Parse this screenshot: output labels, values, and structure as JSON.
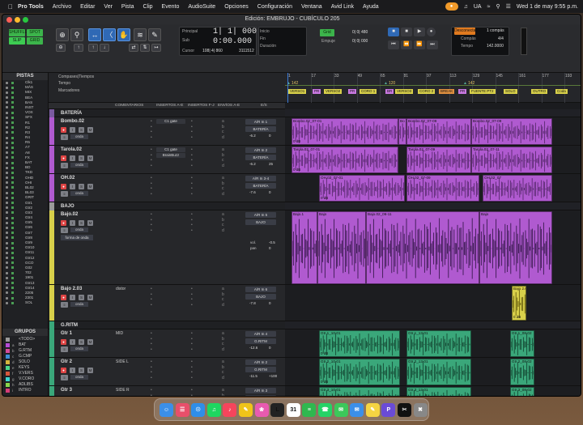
{
  "menubar": {
    "app": "Pro Tools",
    "items": [
      "Archivo",
      "Editar",
      "Ver",
      "Pista",
      "Clip",
      "Evento",
      "AudioSuite",
      "Opciones",
      "Configuración",
      "Ventana",
      "Avid Link",
      "Ayuda"
    ],
    "lang": "UA",
    "clock": "Wed 1 de may  9:55 p.m."
  },
  "window": {
    "title": "Edición: EMBRUJO - CUBÍCULO 205"
  },
  "toolbar": {
    "modes": [
      "SHUFFLE",
      "SPOT",
      "SLIP",
      "GRID"
    ],
    "principal_label": "Principal",
    "principal_value": "1| 1| 000",
    "sub_label": "Sub",
    "sub_value": "0:00.000",
    "cursor_label": "Cursor",
    "cursor_value": "108| 4| 860",
    "cursor_samples": "3111512",
    "inicio_label": "Inicio",
    "fin_label": "Fin",
    "duracion_label": "Duración",
    "grid_label": "Grid",
    "grid_value": "0| 0| 480",
    "empuje_label": "Empuje",
    "empuje_value": "0| 0| 000",
    "compas_label": "Compás",
    "compas_value": "4/4",
    "tempo_label": "Tempo",
    "tempo_value": "142.0000",
    "countoff_label": "Desconectado",
    "countoff_value": "1 compás"
  },
  "panels": {
    "tracks_title": "PISTAS",
    "tracks": [
      "Clk1",
      "MÁS",
      "MIX",
      "BEA",
      "BAS",
      "INST",
      "VOX",
      "SFX",
      "R1",
      "R2",
      "R3",
      "R4",
      "R5",
      "A7",
      "A8",
      "FX",
      "BAT",
      "BD",
      "TKD",
      "OHD",
      "OHI",
      "BL02",
      "BL03",
      "GRIT",
      "Gtr1",
      "Gtr2",
      "Gtr3",
      "Gtr4",
      "Gtr5",
      "Gtr6",
      "Gtr7",
      "Gtr8",
      "Gtr9",
      "Gtr10",
      "Gtr11",
      "Gtr12",
      "GCO",
      "G02",
      "702",
      "1901",
      "Gtr13",
      "Gtr14",
      "2205",
      "2301",
      "SOL"
    ],
    "groups_title": "GRUPOS",
    "groups": [
      {
        "key": "",
        "name": "<TODO>",
        "color": "#999999"
      },
      {
        "key": "a",
        "name": "BAT",
        "color": "#b64bd6"
      },
      {
        "key": "b",
        "name": "G.RTM",
        "color": "#d64b9a"
      },
      {
        "key": "c",
        "name": "G.CMP",
        "color": "#3c8fd6"
      },
      {
        "key": "d",
        "name": "SOLO",
        "color": "#d6b43c"
      },
      {
        "key": "e",
        "name": "KEYS",
        "color": "#4bd68a"
      },
      {
        "key": "f",
        "name": "V.VERS",
        "color": "#d6563c"
      },
      {
        "key": "g",
        "name": "V.CORO",
        "color": "#3cd6d0"
      },
      {
        "key": "h",
        "name": "ADLIBS",
        "color": "#8ad64b"
      },
      {
        "key": "i",
        "name": "INTRO",
        "color": "#d63c78"
      }
    ]
  },
  "ruler": {
    "rows": [
      "Compases|Tiempos",
      "Tempo",
      "Marcadores"
    ],
    "bars": [
      "1",
      "17",
      "33",
      "49",
      "65",
      "81",
      "97",
      "113",
      "129",
      "145",
      "161",
      "177",
      "193"
    ],
    "tempo_values": [
      "142",
      "120",
      "142"
    ],
    "markers": [
      "VERSO1",
      "PR",
      "VERSO2",
      "PR",
      "CORO 1",
      "BR",
      "VERSO3",
      "CORO 2",
      "BREAK",
      "PR",
      "FUENTE PT2",
      "SOLO",
      "OUTRO",
      "Coda"
    ]
  },
  "columns": [
    "COMENTARIOS",
    "INSERTOS A-E",
    "INSERTOS F-J",
    "ENVÍOS A-E",
    "E/S"
  ],
  "folders": {
    "bateria": "BATERÍA",
    "bajo": "BAJO",
    "gritm": "G.RITM"
  },
  "tracks": [
    {
      "name": "Bombo.02",
      "comment": "",
      "insert": "C1 gate",
      "input": "A/R In 1",
      "output": "BATERÍA",
      "vol": "-6.2",
      "pan": "0",
      "clips": [
        "Bombo.02_07-01",
        "Bo",
        "Bombo.02_07-09",
        "Bombo.02_07-09",
        "Bombo.02_07-12"
      ],
      "db": "0 dB"
    },
    {
      "name": "Tarola.02",
      "comment": "",
      "insert": "C1 gate",
      "insert2": "BrainBuzz",
      "input": "A/R In 2",
      "output": "BATERÍA",
      "vol": "-6.2",
      "pan": "25",
      "clips": [
        "Tarola.02_07-01",
        "Tarola.02_07-09",
        "Tarola.02_07-11",
        "Tarola.02_07-08"
      ],
      "db": "0 dB"
    },
    {
      "name": "OH.02",
      "comment": "",
      "insert": "",
      "input": "A/R In 3-4",
      "output": "BATERÍA",
      "vol": "-7.6",
      "pan": "0",
      "clips": [
        "OH.02_07-01",
        "OH.02_07-09",
        "OH.02_07",
        "OH.02_07-13"
      ],
      "db": "0 dB"
    },
    {
      "name": "Bajo.02",
      "comment": "",
      "insert": "",
      "input": "A/R In 5",
      "output": "BAJO",
      "vol": "-0.5",
      "pan": "0",
      "clips": [
        "Bajo.1",
        "Bajo",
        "Bajo.02_06-11",
        "Bajo"
      ],
      "mode": "forma de onda",
      "vol_label": "vol.",
      "pan_label": "pan"
    },
    {
      "name": "Bajo 2.03",
      "comment": "distor",
      "insert": "",
      "input": "A/R In 6",
      "output": "BAJO",
      "vol": "-7.8",
      "pan": "0",
      "clips": [
        "Bajo 2.03"
      ],
      "db": "0 dB"
    },
    {
      "name": "Gtr 1",
      "comment": "MID",
      "insert": "",
      "input": "A/R In 4",
      "output": "G.RITM",
      "vol": "-12.6",
      "pan": "0",
      "clips": [
        "Gtr 1_10-01",
        "Gtr 1_13-01",
        "Gtr 1_08-02"
      ],
      "db": "0 dB"
    },
    {
      "name": "Gtr 2",
      "comment": "SIDE L",
      "insert": "",
      "input": "A/R In 2",
      "output": "G.RITM",
      "vol": "-11.5",
      "pan": "+100",
      "clips": [
        "Gtr 2_10-01",
        "Gtr 2_13-01",
        "Gtr 2_08-02"
      ],
      "db": "0 dB"
    },
    {
      "name": "Gtr 3",
      "comment": "SIDE R",
      "insert": "",
      "input": "A/R In 3",
      "output": "G.RITM",
      "vol": "",
      "pan": "",
      "clips": [
        "Gtr 3_10-01",
        "Gtr 3_13-01",
        "Gtr 3_08-02"
      ],
      "db": "0 dB"
    }
  ],
  "dock": [
    "Finder",
    "Launchpad",
    "Safari",
    "Spotify",
    "Music",
    "Notes",
    "Photos",
    "Live",
    "Calendar",
    "Numbers",
    "WhatsApp",
    "Messages",
    "Mail",
    "Notes2",
    "Pro Tools",
    "Capcut",
    "Trash"
  ],
  "colors": {
    "purple": "#b05ad0",
    "green": "#3aa77a",
    "yellow": "#d8d04a",
    "selected": "#2f69b5"
  }
}
